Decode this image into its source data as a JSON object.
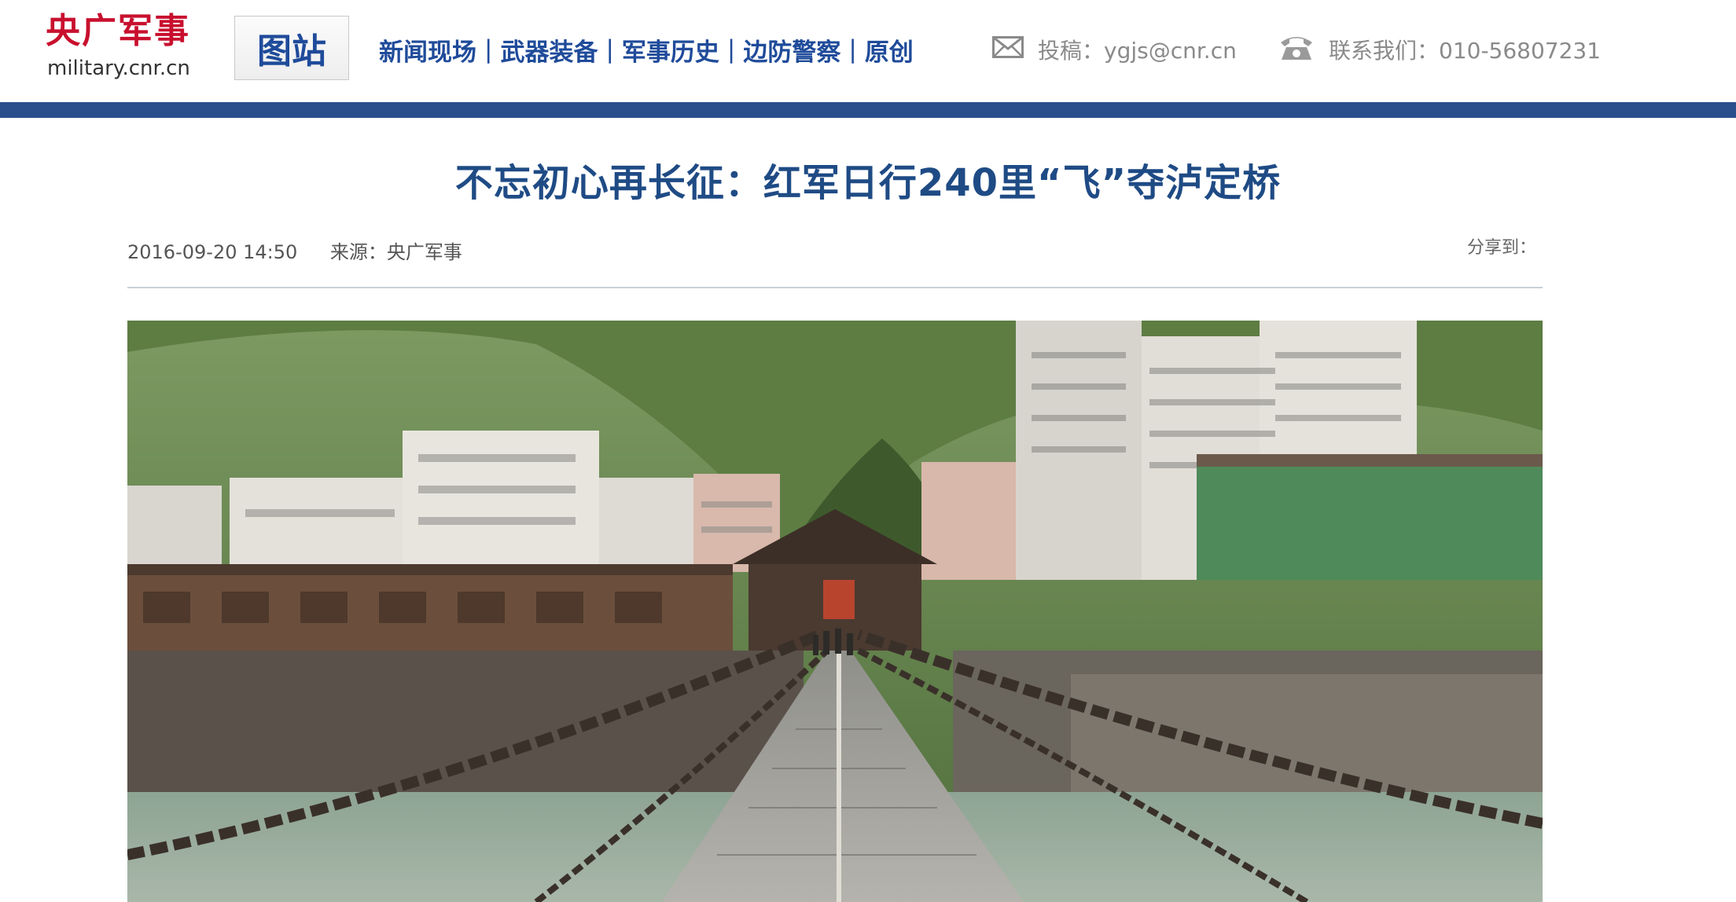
{
  "header": {
    "logo_cn": "央广军事",
    "logo_en": "military.cnr.cn",
    "tuzhan_label": "图站",
    "nav": [
      "新闻现场",
      "武器装备",
      "军事历史",
      "边防警察",
      "原创"
    ],
    "separator": "|",
    "submit_text": "投稿：ygjs@cnr.cn",
    "contact_text": "联系我们：010-56807231",
    "icons": {
      "submit": "envelope-icon",
      "contact": "telephone-icon"
    }
  },
  "article": {
    "title": "不忘初心再长征：红军日行240里“飞”夺泸定桥",
    "date": "2016-09-20 14:50",
    "source": "来源：央广军事",
    "share_label": "分享到："
  },
  "colors": {
    "brand_red": "#c8102e",
    "nav_blue": "#1f4b9a",
    "bar_blue": "#2b4f8c",
    "title_blue": "#1f4b85"
  }
}
